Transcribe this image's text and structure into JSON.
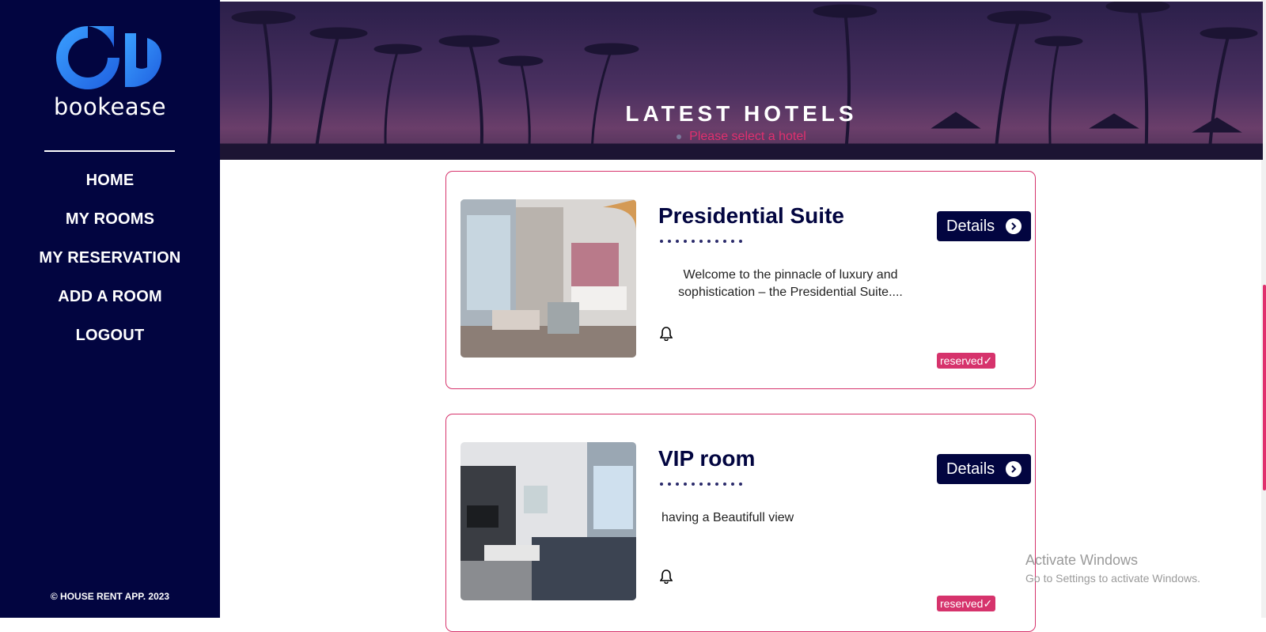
{
  "sidebar": {
    "logo_text": "bookease",
    "nav": [
      {
        "label": "HOME"
      },
      {
        "label": "MY ROOMS"
      },
      {
        "label": "MY RESERVATION"
      },
      {
        "label": "ADD A ROOM"
      },
      {
        "label": "LOGOUT"
      }
    ],
    "copyright": "© HOUSE RENT APP. 2023"
  },
  "hero": {
    "title": "LATEST HOTELS",
    "subtitle": "Please select a hotel"
  },
  "cards": [
    {
      "title": "Presidential Suite",
      "description": "Welcome to the pinnacle of luxury and sophistication – the Presidential Suite....",
      "details_label": "Details",
      "status": "reserved✓"
    },
    {
      "title": "VIP room",
      "description": "having a Beautifull view",
      "details_label": "Details",
      "status": "reserved✓"
    }
  ],
  "watermark": {
    "line1": "Activate Windows",
    "line2": "Go to Settings to activate Windows."
  },
  "colors": {
    "sidebar_bg": "#020540",
    "accent_pink": "#d6336c",
    "logo_blue": "#2f7cf6"
  }
}
